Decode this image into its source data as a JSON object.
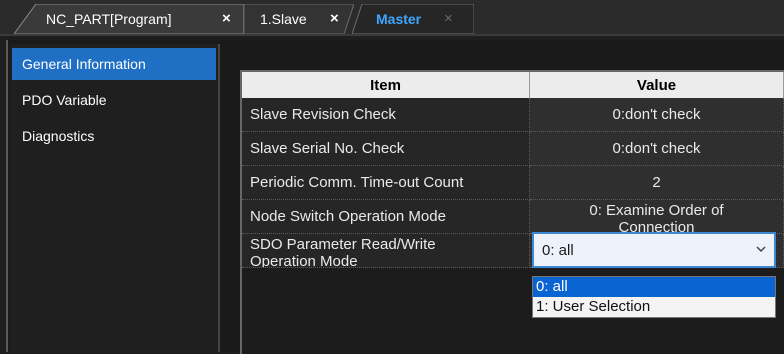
{
  "tabs": [
    {
      "label": "NC_PART[Program]",
      "close": "×"
    },
    {
      "label": "1.Slave",
      "close": "×"
    },
    {
      "label": "Master",
      "close": "×",
      "active": true
    }
  ],
  "sidebar": {
    "items": [
      {
        "label": "General Information",
        "active": true
      },
      {
        "label": "PDO Variable"
      },
      {
        "label": "Diagnostics"
      }
    ]
  },
  "grid": {
    "headers": {
      "item": "Item",
      "value": "Value"
    },
    "rows": [
      {
        "item": "Slave Revision Check",
        "value": "0:don't check"
      },
      {
        "item": "Slave Serial No. Check",
        "value": "0:don't check"
      },
      {
        "item": "Periodic Comm. Time-out Count",
        "value": "2"
      },
      {
        "item": "Node Switch Operation Mode",
        "value": "0: Examine Order of",
        "value_cut": "Connection"
      },
      {
        "item": "SDO Parameter Read/Write",
        "item_cut": "Operation Mode"
      }
    ]
  },
  "combo": {
    "selected": "0: all",
    "options": [
      "0: all",
      "1: User Selection"
    ]
  },
  "colors": {
    "accent": "#1f6fc5",
    "active_tab_text": "#3fa6ff",
    "selection": "#0a64d2"
  },
  "icons": {
    "tab_close": "close-icon",
    "combo_arrow": "chevron-down-icon"
  }
}
